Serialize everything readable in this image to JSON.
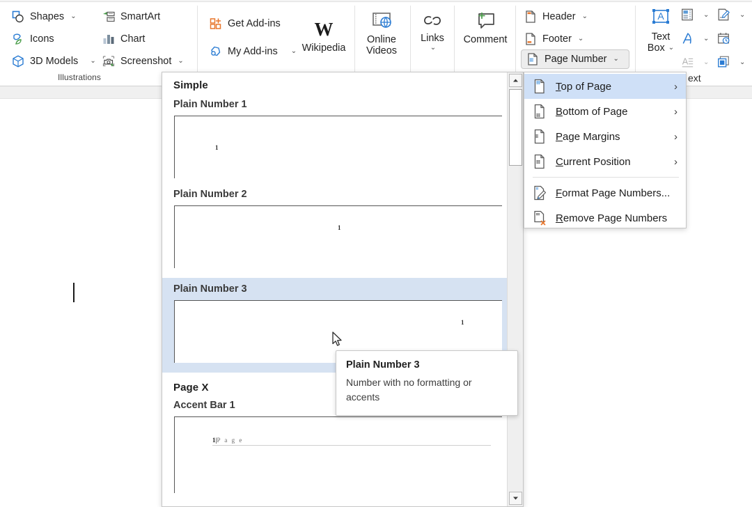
{
  "ribbon": {
    "illustrations": {
      "label": "Illustrations",
      "items": [
        {
          "label": "Shapes",
          "icon": "shapes-icon",
          "dropdown": true
        },
        {
          "label": "SmartArt",
          "icon": "smartart-icon",
          "dropdown": false
        },
        {
          "label": "Icons",
          "icon": "icons-icon",
          "dropdown": false
        },
        {
          "label": "Chart",
          "icon": "chart-icon",
          "dropdown": false
        },
        {
          "label": "3D Models",
          "icon": "3d-models-icon",
          "dropdown": true
        },
        {
          "label": "Screenshot",
          "icon": "screenshot-icon",
          "dropdown": true
        }
      ]
    },
    "addins": {
      "items": [
        {
          "label": "Get Add-ins",
          "icon": "get-addins-icon",
          "dropdown": false
        },
        {
          "label": "My Add-ins",
          "icon": "my-addins-icon",
          "dropdown": true
        },
        {
          "label": "Wikipedia",
          "icon": "wikipedia-icon",
          "dropdown": false
        }
      ]
    },
    "media": {
      "online_videos": "Online\nVideos",
      "online_videos_line1": "Online",
      "online_videos_line2": "Videos",
      "links": "Links",
      "comment": "Comment"
    },
    "header_footer": {
      "header": "Header",
      "footer": "Footer",
      "page_number": "Page Number"
    },
    "text_group": {
      "text_box_line1": "Text",
      "text_box_line2": "Box",
      "label_clipped": "ext",
      "icons": [
        {
          "name": "quick-parts-icon",
          "dropdown": true
        },
        {
          "name": "signature-line-icon",
          "dropdown": true
        },
        {
          "name": "wordart-icon",
          "dropdown": true
        },
        {
          "name": "date-time-icon",
          "dropdown": false
        },
        {
          "name": "drop-cap-icon",
          "dropdown": true
        },
        {
          "name": "object-icon",
          "dropdown": true
        }
      ]
    }
  },
  "gallery": {
    "heading": "Simple",
    "section2_heading": "Page X",
    "items": [
      {
        "title": "Plain Number 1",
        "number": "1",
        "align": "left",
        "selected": false
      },
      {
        "title": "Plain Number 2",
        "number": "1",
        "align": "center",
        "selected": false
      },
      {
        "title": "Plain Number 3",
        "number": "1",
        "align": "right",
        "selected": true
      }
    ],
    "accent": {
      "title": "Accent Bar 1",
      "number": "1",
      "divider": "|",
      "word": "P a g e"
    }
  },
  "tooltip": {
    "title": "Plain Number 3",
    "description": "Number with no formatting or accents"
  },
  "menu": {
    "items": [
      {
        "label": "Top of Page",
        "accel": "T",
        "rest": "op of Page",
        "icon": "page-top-number-icon",
        "submenu": true,
        "highlighted": true
      },
      {
        "label": "Bottom of Page",
        "accel": "B",
        "rest": "ottom of Page",
        "icon": "page-bottom-number-icon",
        "submenu": true,
        "highlighted": false
      },
      {
        "label": "Page Margins",
        "accel": "P",
        "rest": "age Margins",
        "icon": "page-margins-number-icon",
        "submenu": true,
        "highlighted": false
      },
      {
        "label": "Current Position",
        "accel": "C",
        "rest": "urrent Position",
        "icon": "page-current-number-icon",
        "submenu": true,
        "highlighted": false
      },
      {
        "label": "Format Page Numbers...",
        "accel": "F",
        "rest": "ormat Page Numbers...",
        "icon": "format-page-numbers-icon",
        "submenu": false,
        "highlighted": false
      },
      {
        "label": "Remove Page Numbers",
        "accel": "R",
        "rest": "emove Page Numbers",
        "icon": "remove-page-numbers-icon",
        "submenu": false,
        "highlighted": false
      }
    ],
    "submenu_arrow": "›"
  },
  "colors": {
    "menu_highlight": "#cfe0f7",
    "gallery_selected": "#d6e2f2",
    "accent_orange": "#e8762c",
    "accent_blue": "#2b7cd3",
    "accent_green": "#4a9e4a"
  }
}
